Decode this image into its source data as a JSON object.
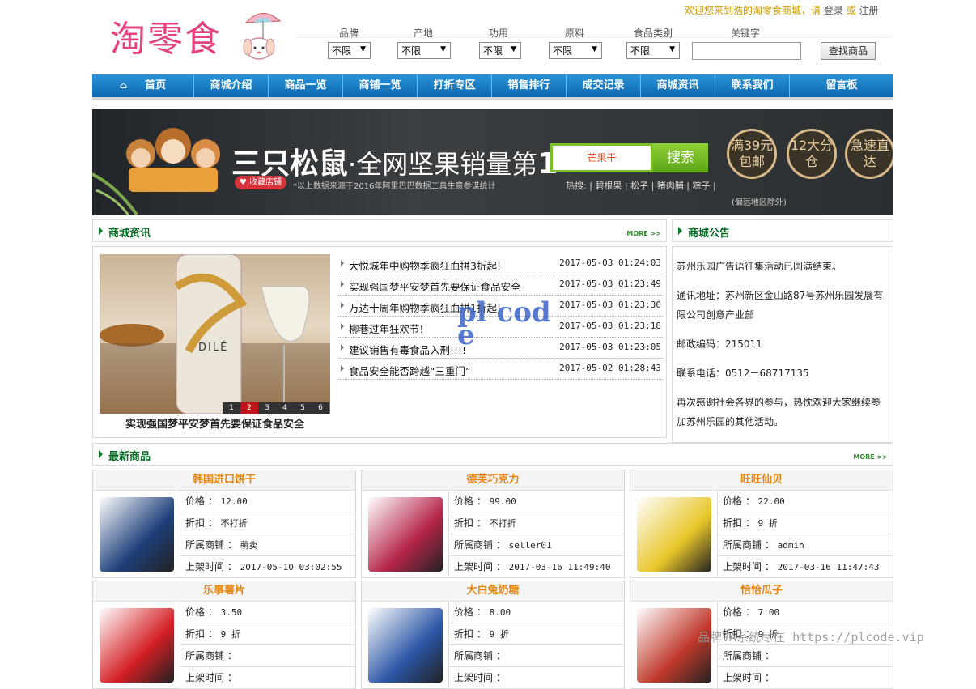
{
  "logo": {
    "text": "淘零食"
  },
  "header": {
    "welcome": "欢迎您来到浩的淘零食商城，请",
    "login": "登录",
    "or": "或",
    "register": "注册"
  },
  "filters": [
    {
      "label": "品牌",
      "value": "不限"
    },
    {
      "label": "产地",
      "value": "不限"
    },
    {
      "label": "功用",
      "value": "不限"
    },
    {
      "label": "原料",
      "value": "不限"
    },
    {
      "label": "食品类别",
      "value": "不限"
    }
  ],
  "search": {
    "label": "关键字",
    "value": "",
    "button": "查找商品"
  },
  "nav": [
    "首页",
    "商城介绍",
    "商品一览",
    "商铺一览",
    "打折专区",
    "销售排行",
    "成交记录",
    "商城资讯",
    "联系我们",
    "留言板"
  ],
  "banner": {
    "brand": "三只松鼠",
    "slogan": "·全网坚果销量第",
    "one": "1",
    "star": "*",
    "fav": "收藏店铺",
    "note": "*以上数据来源于2016年阿里巴巴数据工具生意参谋统计",
    "search_value": "芒果干",
    "search_btn": "搜索",
    "hot": "热搜: | 碧根果 | 松子 | 猪肉脯 | 粽子 |",
    "badges": [
      "满39元包邮",
      "12大分仓",
      "急速直达"
    ],
    "badge_note": "(偏远地区除外)"
  },
  "news": {
    "title": "商城资讯",
    "more": "MORE >>",
    "caption": "实现强国梦平安梦首先要保证食品安全",
    "pager": [
      "1",
      "2",
      "3",
      "4",
      "5",
      "6"
    ],
    "active_page": "2",
    "bottle_label": "DILÉ",
    "watermark": "pl code",
    "items": [
      {
        "title": "大悦城年中购物季疯狂血拼3折起!",
        "date": "2017-05-03 01:24:03"
      },
      {
        "title": "实现强国梦平安梦首先要保证食品安全",
        "date": "2017-05-03 01:23:49"
      },
      {
        "title": "万达十周年购物季疯狂血拼1折起!",
        "date": "2017-05-03 01:23:30"
      },
      {
        "title": "柳巷过年狂欢节!",
        "date": "2017-05-03 01:23:18"
      },
      {
        "title": "建议销售有毒食品入刑!!!!",
        "date": "2017-05-03 01:23:05"
      },
      {
        "title": "食品安全能否跨越“三重门”",
        "date": "2017-05-02 01:28:43"
      }
    ]
  },
  "notice": {
    "title": "商城公告",
    "paragraphs": [
      "苏州乐园广告语征集活动已圆满结束。",
      "通讯地址：苏州新区金山路87号苏州乐园发展有限公司创意产业部",
      "邮政编码：215011",
      "联系电话：0512－68717135",
      "再次感谢社会各界的参与，热忱欢迎大家继续参加苏州乐园的其他活动。"
    ]
  },
  "newest": {
    "title": "最新商品",
    "more": "MORE >>",
    "labels": {
      "price": "价格 ：",
      "discount": "折扣 ：",
      "shop": "所属商铺 ：",
      "time": "上架时间 ："
    },
    "products": [
      {
        "name": "韩国进口饼干",
        "price": "12.00",
        "discount": "不打折",
        "shop": "萌卖",
        "time": "2017-05-10 03:02:55",
        "color": "#1d3f7a"
      },
      {
        "name": "德芙巧克力",
        "price": "99.00",
        "discount": "不打折",
        "shop": "seller01",
        "time": "2017-03-16 11:49:40",
        "color": "#b5254a"
      },
      {
        "name": "旺旺仙贝",
        "price": "22.00",
        "discount": "9 折",
        "shop": "admin",
        "time": "2017-03-16 11:47:43",
        "color": "#e8c62a"
      },
      {
        "name": "乐事薯片",
        "price": "3.50",
        "discount": "9 折",
        "shop": "",
        "time": "",
        "color": "#d31e24"
      },
      {
        "name": "大白兔奶糖",
        "price": "8.00",
        "discount": "9 折",
        "shop": "",
        "time": "",
        "color": "#2b56a6"
      },
      {
        "name": "恰恰瓜子",
        "price": "7.00",
        "discount": "9 折",
        "shop": "",
        "time": "",
        "color": "#c0392b"
      }
    ]
  },
  "footer_watermark": "品牌VA系统尽在 https://plcode.vip"
}
